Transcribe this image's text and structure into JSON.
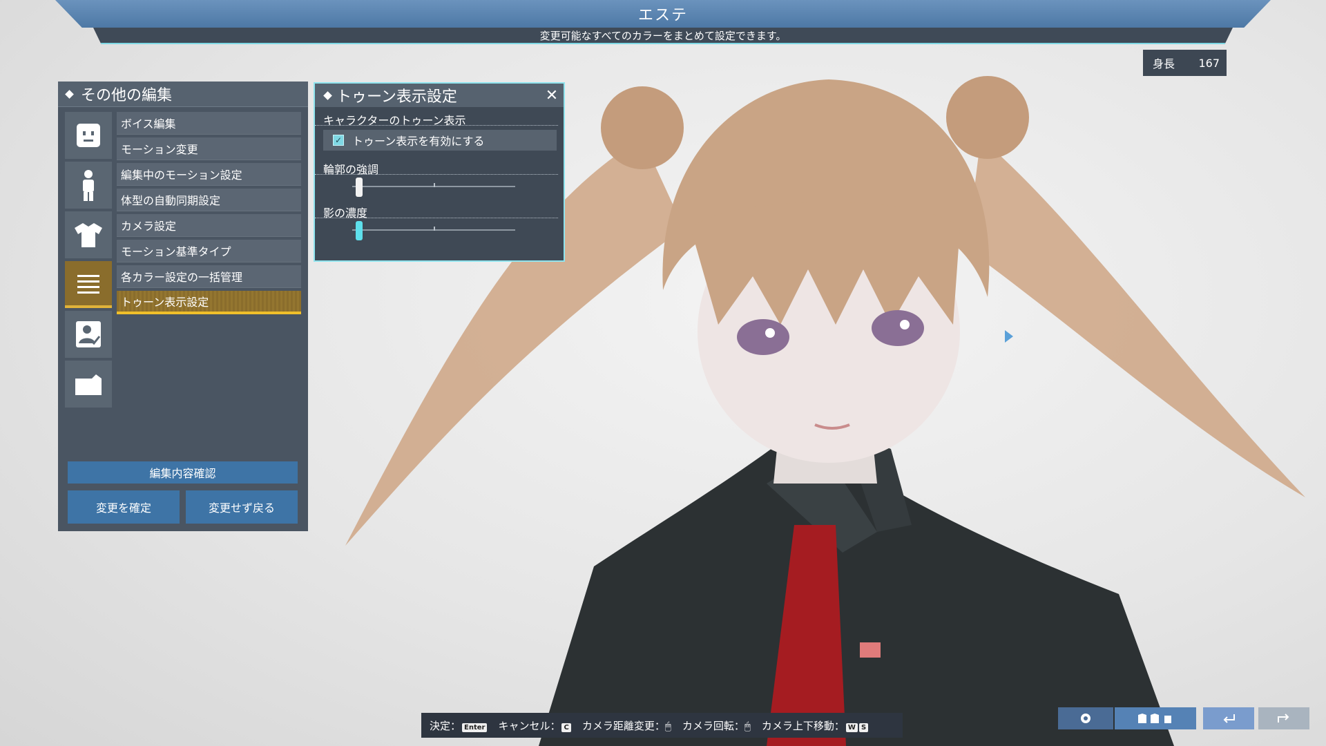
{
  "header": {
    "title": "エステ",
    "subtitle": "変更可能なすべてのカラーをまとめて設定できます。"
  },
  "height_box": {
    "label": "身長",
    "value": "167"
  },
  "left_panel": {
    "title": "その他の編集",
    "category_icons": [
      "face-icon",
      "body-icon",
      "shirt-icon",
      "menu-lines-icon",
      "profile-check-icon",
      "folder-icon"
    ],
    "active_category": 3,
    "menu_items": [
      {
        "label": "ボイス編集"
      },
      {
        "label": "モーション変更"
      },
      {
        "label": "編集中のモーション設定"
      },
      {
        "label": "体型の自動同期設定"
      },
      {
        "label": "カメラ設定"
      },
      {
        "label": "モーション基準タイプ"
      },
      {
        "label": "各カラー設定の一括管理"
      },
      {
        "label": "トゥーン表示設定"
      }
    ],
    "active_menu_index": 7,
    "confirm_edit_label": "編集内容確認",
    "apply_label": "変更を確定",
    "revert_label": "変更せず戻る"
  },
  "toon_panel": {
    "title": "トゥーン表示設定",
    "section_character": "キャラクターのトゥーン表示",
    "enable_label": "トゥーン表示を有効にする",
    "enable_checked": true,
    "outline_label": "輪郭の強調",
    "outline_value": 0.02,
    "shadow_label": "影の濃度",
    "shadow_value": 0.02
  },
  "hints": {
    "decide_label": "決定：",
    "decide_key": "Enter",
    "cancel_label": "キャンセル：",
    "cancel_key": "C",
    "zoom_label": "カメラ距離変更：",
    "rotate_label": "カメラ回転：",
    "vertical_label": "カメラ上下移動：",
    "vertical_key_w": "W",
    "vertical_key_s": "S"
  },
  "colors": {
    "panel_bg": "#4a5562",
    "active_gold": "#f0bf2a",
    "accent_cyan": "#7fd8e4",
    "banner_blue": "#5a84b0",
    "button_blue": "#3e74a6"
  }
}
